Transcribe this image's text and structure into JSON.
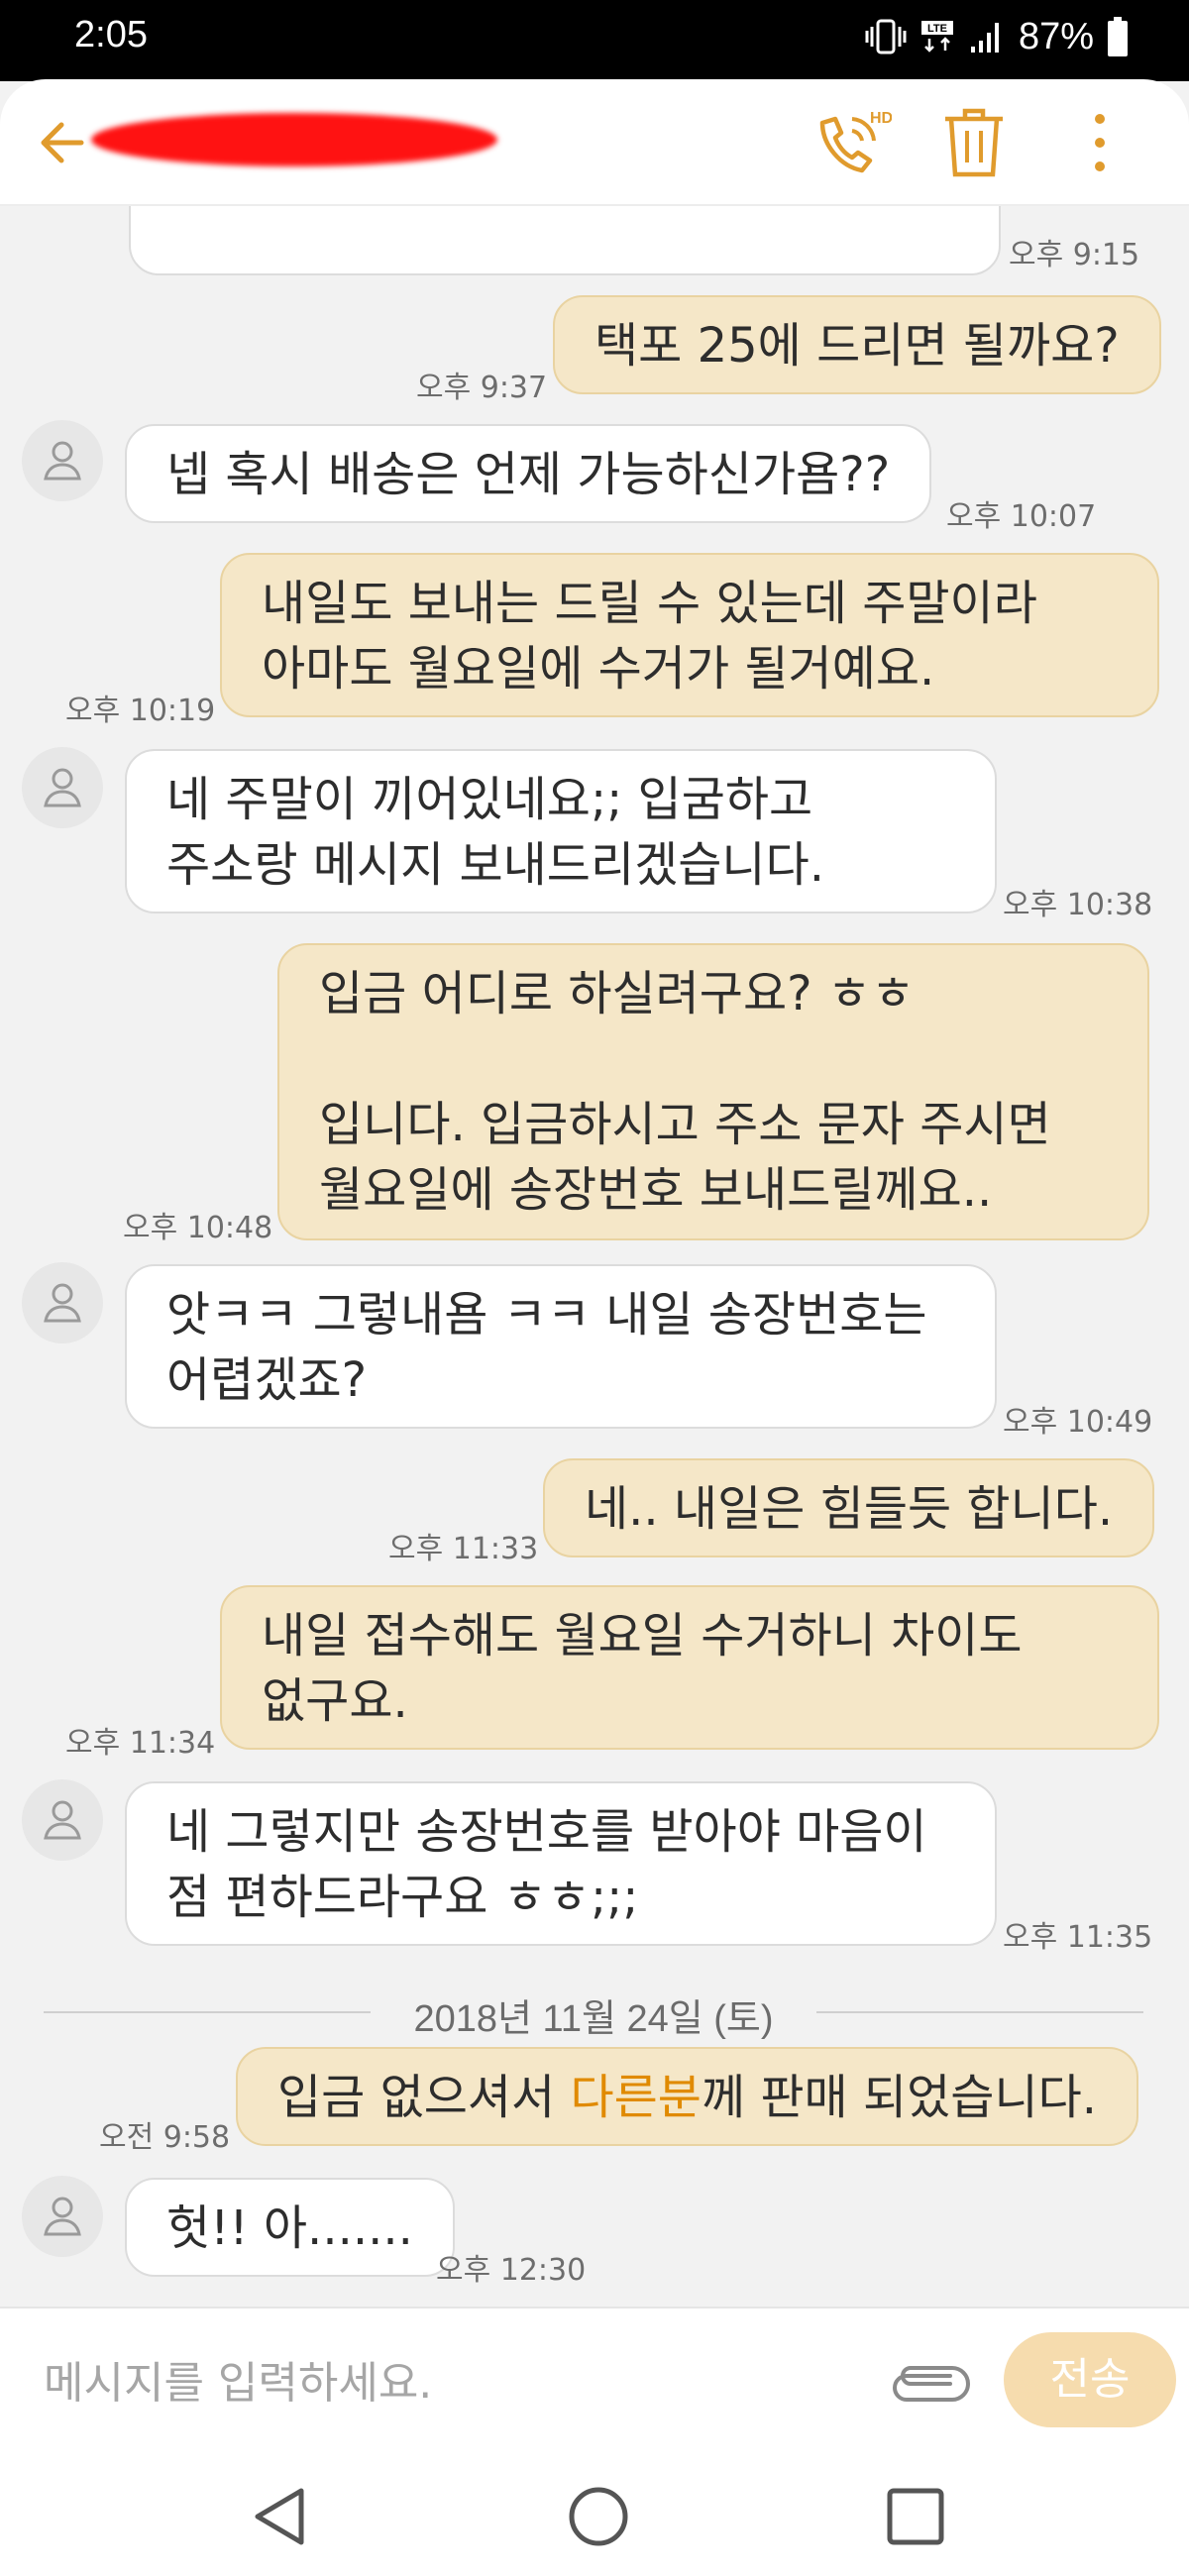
{
  "status_bar": {
    "time": "2:05",
    "battery_percent": "87%",
    "network": "LTE"
  },
  "header": {
    "back_icon": "arrow-left-icon",
    "contact_name_redacted": true,
    "call_hd_label": "HD",
    "accent": "#e09b2d"
  },
  "messages": [
    {
      "dir": "in",
      "lines": [
        ""
      ],
      "time": "오후 9:15"
    },
    {
      "dir": "out",
      "lines": [
        "택포 25에 드리면 될까요?"
      ],
      "time": "오후 9:37"
    },
    {
      "dir": "in",
      "lines": [
        "넵 혹시 배송은 언제 가능하신가욤??"
      ],
      "time": "오후 10:07"
    },
    {
      "dir": "out",
      "lines": [
        "내일도 보내는 드릴 수 있는데 주말이라",
        "아마도 월요일에 수거가 될거예요."
      ],
      "time": "오후 10:19"
    },
    {
      "dir": "in",
      "lines": [
        "네 주말이 끼어있네요;; 입굼하고",
        "주소랑 메시지 보내드리겠습니다."
      ],
      "time": "오후 10:38"
    },
    {
      "dir": "out",
      "lines": [
        "입금 어디로 하실려구요? ㅎㅎ",
        "",
        "입니다. 입금하시고 주소 문자 주시면",
        "월요일에 송장번호 보내드릴께요.."
      ],
      "time": "오후 10:48"
    },
    {
      "dir": "in",
      "lines": [
        "앗ㅋㅋ 그렇내욤 ㅋㅋ 내일 송장번호는",
        "어렵겠죠?"
      ],
      "time": "오후 10:49"
    },
    {
      "dir": "out",
      "lines": [
        "네.. 내일은 힘들듯 합니다."
      ],
      "time": "오후 11:33"
    },
    {
      "dir": "out",
      "lines": [
        "내일 접수해도 월요일 수거하니 차이도",
        "없구요."
      ],
      "time": "오후 11:34"
    },
    {
      "dir": "in",
      "lines": [
        "네 그렇지만 송장번호를 받아야 마음이",
        "점 편하드라구요 ㅎㅎ;;;"
      ],
      "time": "오후 11:35"
    },
    {
      "dir": "out",
      "lines": [
        "입금 없으셔서 ",
        "다른분",
        "께 판매 되었습니다."
      ],
      "time": "오전 9:58"
    },
    {
      "dir": "in",
      "lines": [
        "헛!! 아......."
      ],
      "time": "오후 12:30"
    }
  ],
  "date_separator": "2018년 11월 24일 (토)",
  "composer": {
    "placeholder": "메시지를 입력하세요.",
    "send_label": "전송"
  },
  "colors": {
    "incoming_bg": "#ffffff",
    "outgoing_bg": "#f5e7c8",
    "highlight": "#e08a00",
    "send_bg": "#f6dcae"
  }
}
